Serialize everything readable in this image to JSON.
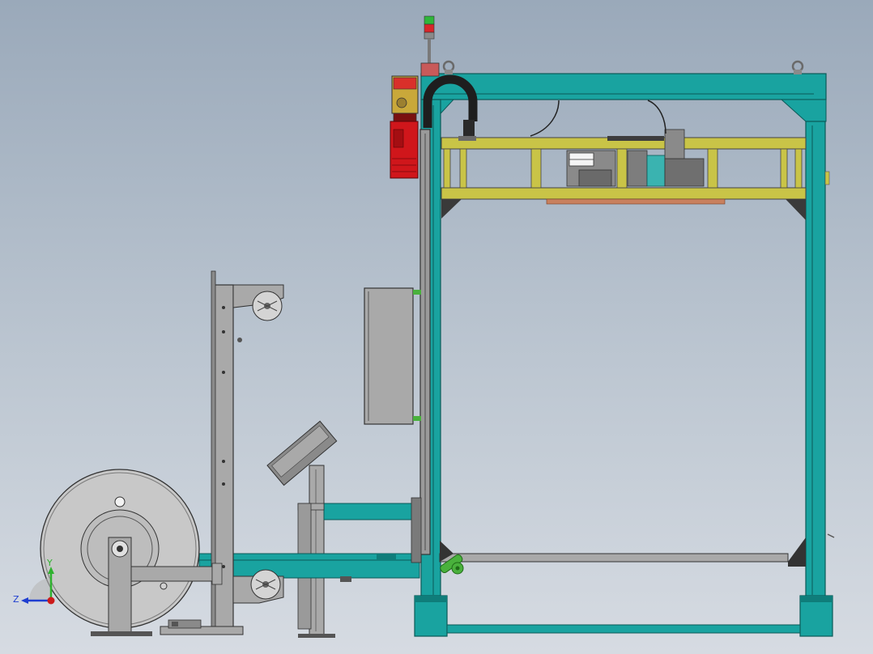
{
  "scene": {
    "kind": "cad-assembly-side-view",
    "colors": {
      "background_top": "#9aa9ba",
      "background_bottom": "#d6dbe2",
      "frame_teal": "#19a3a0",
      "frame_teal_dark": "#0f7d7a",
      "carriage_yellow": "#c9c447",
      "motor_red": "#d0161b",
      "gearbox_yellow": "#c9a83a",
      "steel_gray": "#a9a9a9",
      "steel_dark": "#5a5a5a",
      "reel_light": "#c8c8c8",
      "lever_green": "#49b13c",
      "cable_black": "#2a2a2a",
      "strip_copper": "#c8805e"
    },
    "signal_tower": {
      "lights": [
        "green",
        "red",
        "gray"
      ]
    },
    "components": [
      "main-frame",
      "top-carriage",
      "cable-chain",
      "drive-motor",
      "signal-tower",
      "electrical-cabinet",
      "control-panel",
      "strap-dispenser-tower",
      "strap-reel",
      "feed-conveyor",
      "base-rail"
    ]
  },
  "triad": {
    "y_label": "Y",
    "z_label": "Z",
    "y_color": "#2fb22f",
    "z_color": "#1f3fd0",
    "origin_color": "#cc1b1b"
  }
}
